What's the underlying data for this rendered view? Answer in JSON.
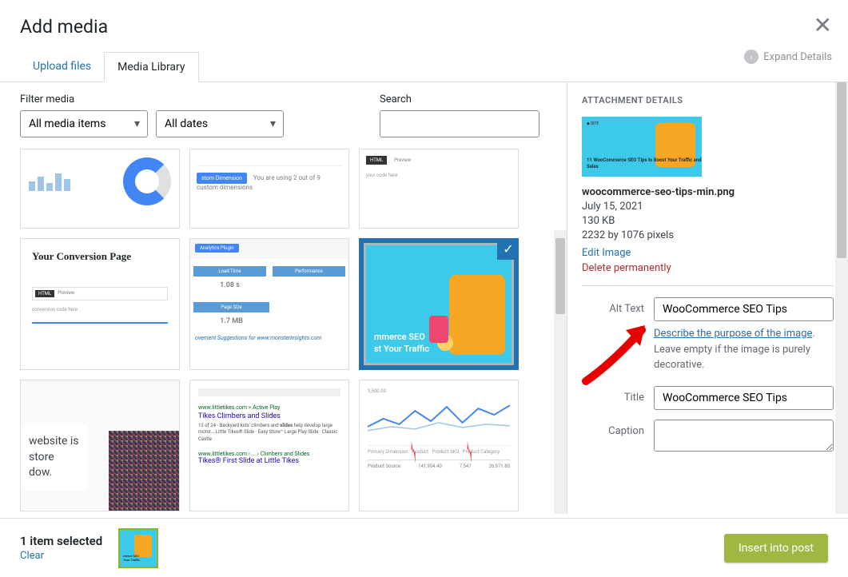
{
  "header": {
    "title": "Add media",
    "expand": "Expand Details"
  },
  "tabs": {
    "upload": "Upload files",
    "library": "Media Library"
  },
  "filters": {
    "media_label": "Filter media",
    "media_value": "All media items",
    "dates_value": "All dates",
    "search_label": "Search"
  },
  "grid": {
    "conversion_title": "Your Conversion Page",
    "load_time": "1.08 s",
    "page_size": "1.7 MB",
    "load_label": "Load Time",
    "size_label": "Page Size",
    "perf_label": "Performance",
    "suggestions": "ovement Suggestions for www.monsterinsights.com",
    "website_text": "website is\nstore\ndow.",
    "search_result_domain": "www.littletikes.com > Active Play",
    "search_link1": "Tikes Climbers and Slides",
    "search_link2": "Tikes® First Slide at Little Tikes",
    "sel_title": "mmerce SEO\nst Your Traffic",
    "custom_dim": "You are using 2 out of 9 custom dimensions",
    "chart_nums": [
      "141,904.40",
      "7,547",
      "26,971.80"
    ]
  },
  "details": {
    "heading": "ATTACHMENT DETAILS",
    "filename": "woocommerce-seo-tips-min.png",
    "date": "July 15, 2021",
    "size": "130 KB",
    "dimensions": "2232 by 1076 pixels",
    "edit": "Edit Image",
    "delete": "Delete permanently",
    "alt_label": "Alt Text",
    "alt_value": "WooCommerce SEO Tips",
    "helper_link": "Describe the purpose of the image",
    "helper_text": ". Leave empty if the image is purely decorative.",
    "title_label": "Title",
    "title_value": "WooCommerce SEO Tips",
    "caption_label": "Caption",
    "thumb_text": "11 WooCommerce SEO Tips to Boost Your Traffic and Sales"
  },
  "footer": {
    "selected": "1 item selected",
    "clear": "Clear",
    "insert": "Insert into post"
  }
}
